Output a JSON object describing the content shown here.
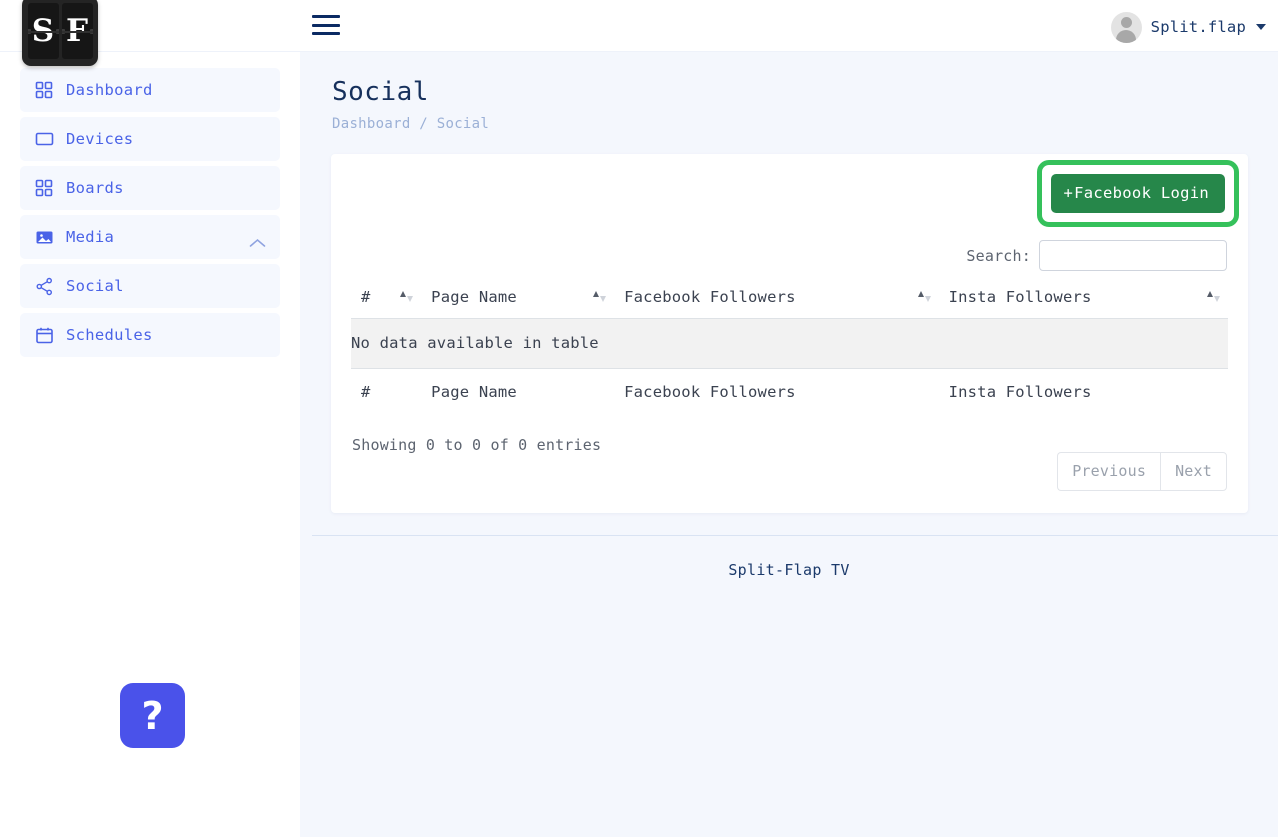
{
  "brand": {
    "logo_chars": [
      "S",
      "F"
    ],
    "logo_name": "split-flap-logo"
  },
  "topbar": {
    "menu_icon": "hamburger-icon",
    "user": {
      "name": "Split.flap",
      "avatar_icon": "user-avatar-icon",
      "caret_icon": "chevron-down-icon"
    }
  },
  "sidebar": {
    "items": [
      {
        "label": "Dashboard",
        "icon": "grid-icon",
        "expandable": false
      },
      {
        "label": "Devices",
        "icon": "monitor-icon",
        "expandable": false
      },
      {
        "label": "Boards",
        "icon": "grid-icon",
        "expandable": false
      },
      {
        "label": "Media",
        "icon": "image-icon",
        "expandable": true,
        "chevron": "chevron-up-icon"
      },
      {
        "label": "Social",
        "icon": "share-icon",
        "expandable": false
      },
      {
        "label": "Schedules",
        "icon": "calendar-icon",
        "expandable": false
      }
    ],
    "help_button": {
      "label": "?",
      "icon": "question-mark-icon"
    }
  },
  "page": {
    "title": "Social",
    "breadcrumb": "Dashboard / Social"
  },
  "card": {
    "primary_action": {
      "plus": "+",
      "label": "Facebook Login",
      "highlighted": true
    },
    "search": {
      "label": "Search:",
      "value": "",
      "placeholder": ""
    },
    "table": {
      "columns": [
        "#",
        "Page Name",
        "Facebook Followers",
        "Insta Followers"
      ],
      "rows": [],
      "empty_message": "No data available in table",
      "sort_icon": "sort-arrows-icon"
    },
    "entries_info": "Showing 0 to 0 of 0 entries",
    "pagination": {
      "previous": "Previous",
      "next": "Next"
    }
  },
  "footer": {
    "text": "Split-Flap TV"
  },
  "colors": {
    "accent_blue": "#4a63e7",
    "brand_navy": "#16305c",
    "button_green": "#26874a",
    "highlight_green": "#35c15b",
    "help_indigo": "#4a52ea",
    "page_bg": "#f4f7fd"
  }
}
